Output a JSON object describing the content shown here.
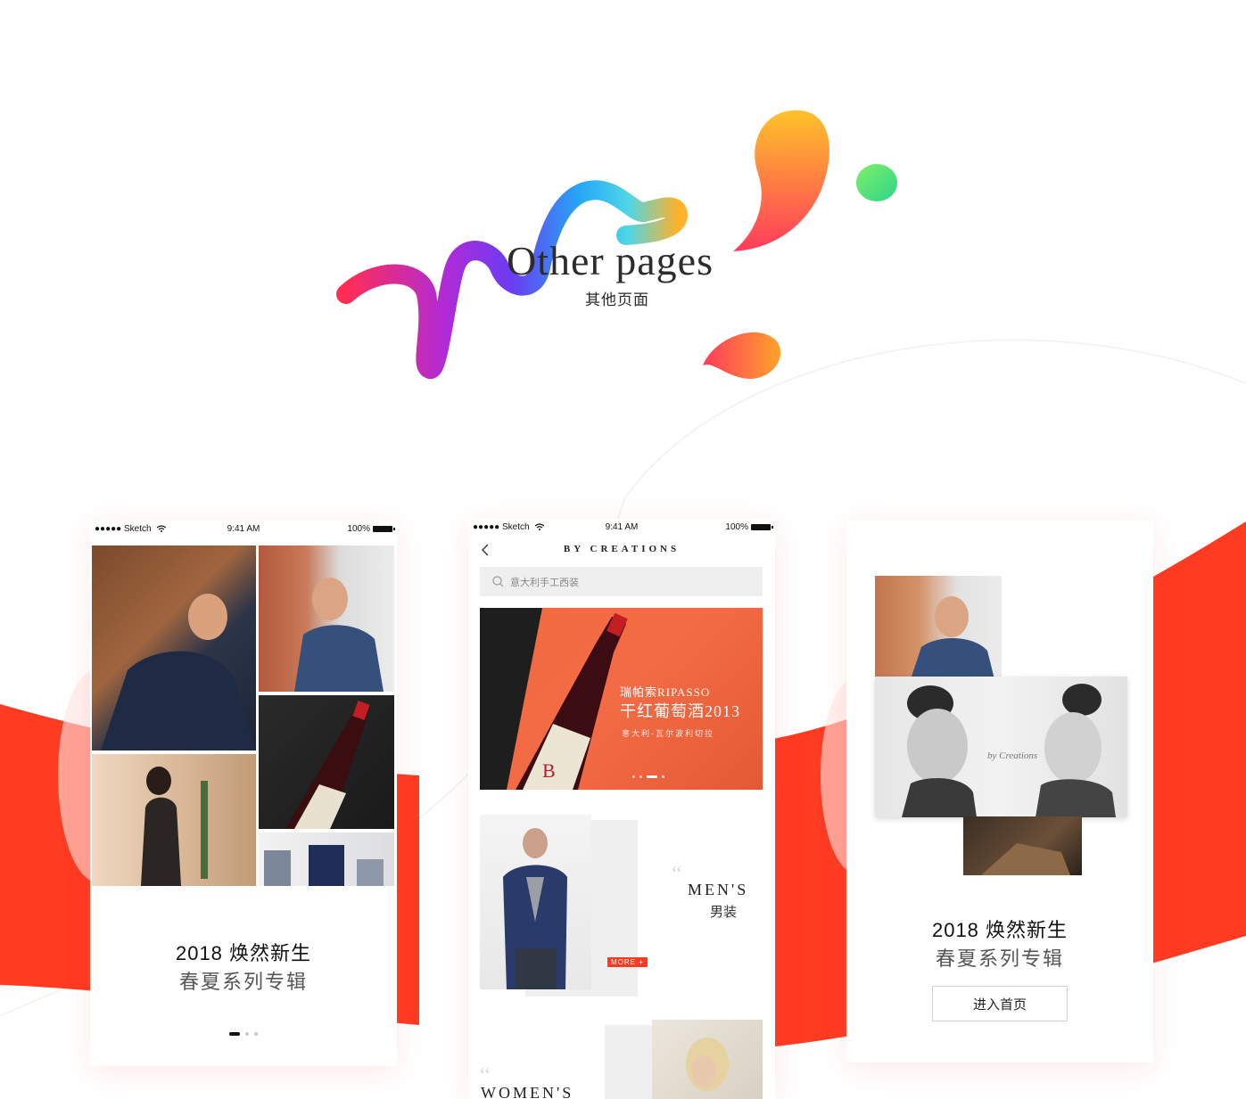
{
  "hero": {
    "title": "Other pages",
    "subtitle": "其他页面"
  },
  "status_bar": {
    "carrier": "Sketch",
    "time": "9:41 AM",
    "battery": "100%"
  },
  "colors": {
    "accent_red": "#ff3b22",
    "ribbon_orange": "#ffb52a",
    "ribbon_pink": "#ff3b5c",
    "ribbon_purple": "#7b3cf2",
    "ribbon_blue": "#2aa8f5",
    "blob_green": "#57dd6a"
  },
  "phone_1": {
    "caption_title": "2018 焕然新生",
    "caption_sub": "春夏系列专辑",
    "pager": {
      "count": 3,
      "active": 1
    }
  },
  "phone_2": {
    "nav_title": "BY CREATIONS",
    "search_placeholder": "意大利手工西装",
    "banner": {
      "line1": "瑞帕索RIPASSO",
      "line2": "干红葡萄酒2013",
      "line3": "意大利-瓦尔波利切拉",
      "pager": {
        "count": 4,
        "active": 3
      }
    },
    "men_section": {
      "en": "MEN'S",
      "cn": "男装",
      "more": "MORE +"
    },
    "women_section": {
      "en": "WOMEN'S"
    }
  },
  "phone_3": {
    "caption_title": "2018 焕然新生",
    "caption_sub": "春夏系列专辑",
    "enter_button": "进入首页"
  },
  "icons": [
    "wifi-icon",
    "battery-icon",
    "back-arrow-icon",
    "search-icon",
    "quote-icon"
  ]
}
